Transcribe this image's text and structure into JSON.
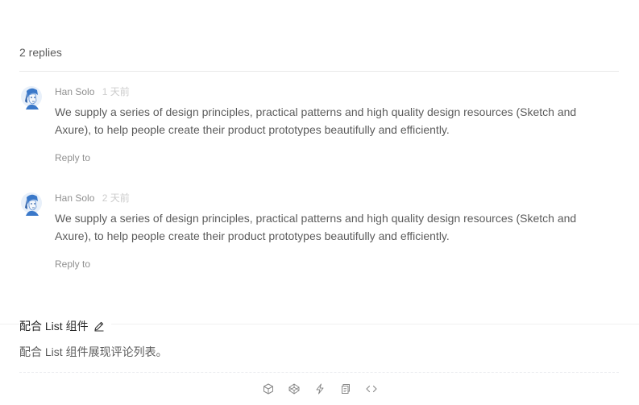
{
  "header": {
    "replies_count": "2 replies"
  },
  "comments": [
    {
      "author": "Han Solo",
      "time": "1 天前",
      "text": "We supply a series of design principles, practical patterns and high quality design resources (Sketch and Axure), to help people create their product prototypes beautifully and efficiently.",
      "action": "Reply to"
    },
    {
      "author": "Han Solo",
      "time": "2 天前",
      "text": "We supply a series of design principles, practical patterns and high quality design resources (Sketch and Axure), to help people create their product prototypes beautifully and efficiently.",
      "action": "Reply to"
    }
  ],
  "doc": {
    "title": "配合 List 组件",
    "description": "配合 List 组件展现评论列表。"
  },
  "toolbar": {
    "icons": [
      "codesandbox-icon",
      "codepen-icon",
      "thunderbolt-icon",
      "copy-icon",
      "code-expand-icon"
    ]
  },
  "colors": {
    "author": "#8c8c8c",
    "time": "#cccccc",
    "divider": "#e8e8e8",
    "avatar_blue": "#3a78c9"
  }
}
